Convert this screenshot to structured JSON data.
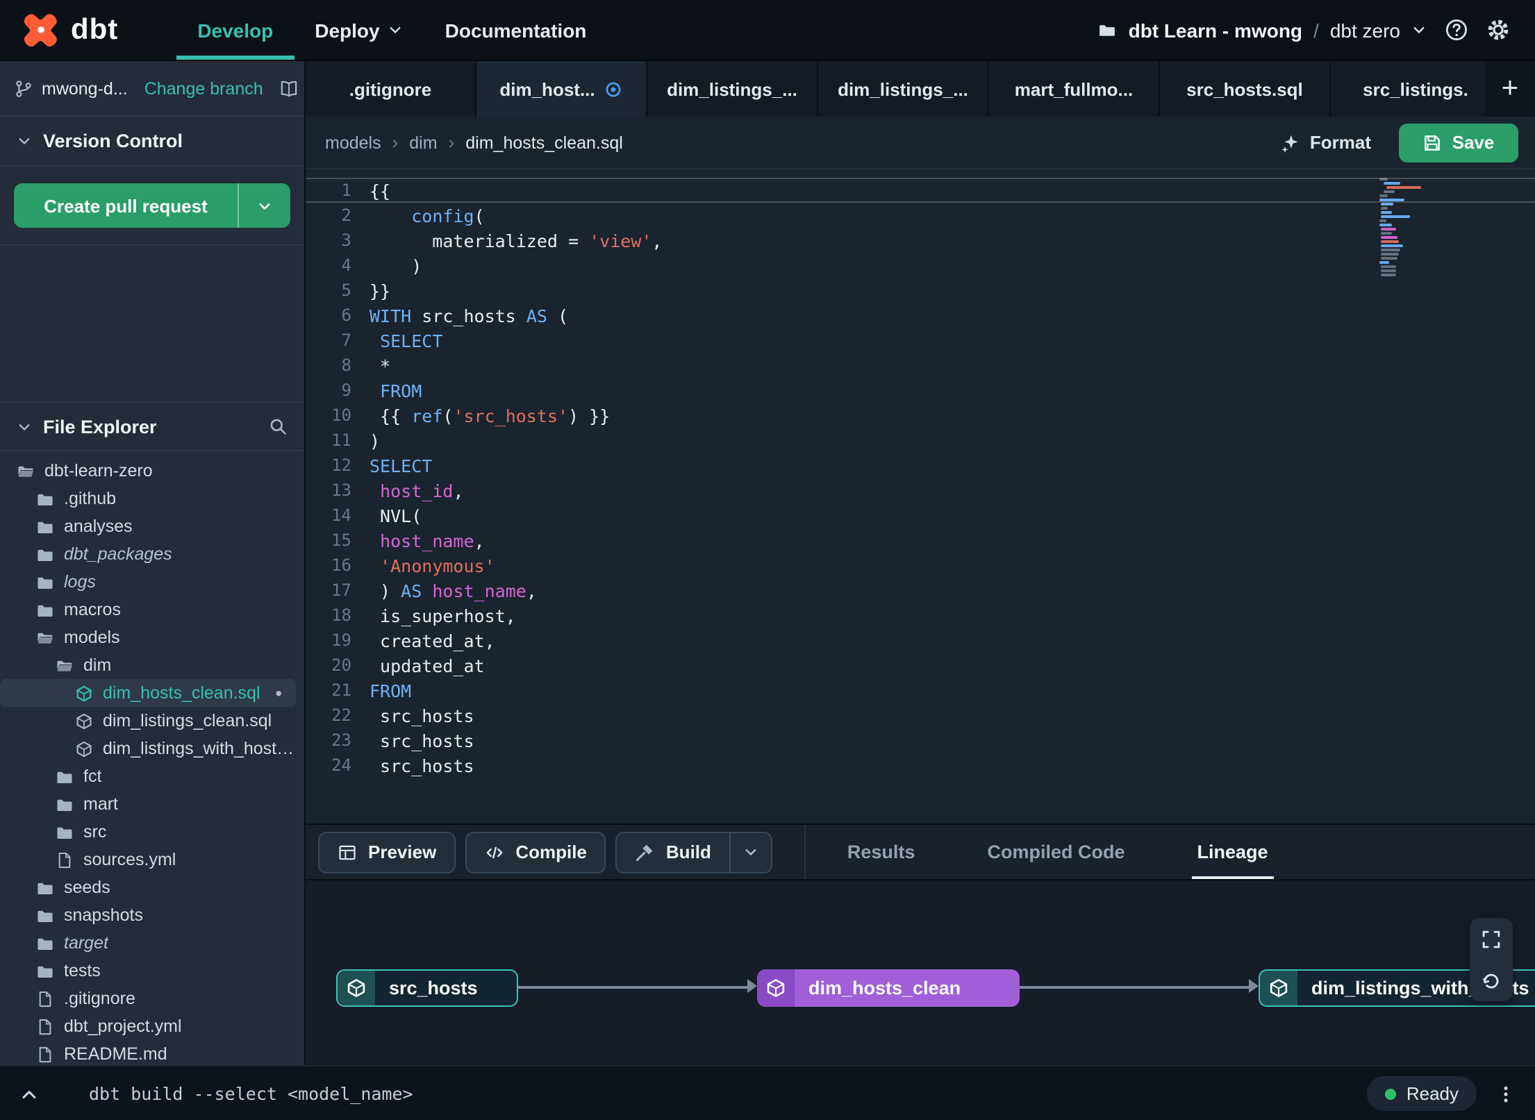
{
  "navbar": {
    "brand": "dbt",
    "items": [
      {
        "label": "Develop",
        "active": true
      },
      {
        "label": "Deploy",
        "caret": true
      },
      {
        "label": "Documentation"
      }
    ],
    "project_name": "dbt Learn - mwong",
    "project_separator": "/",
    "environment": "dbt zero"
  },
  "sidebar": {
    "branch_name": "mwong-d...",
    "change_branch": "Change branch",
    "version_control_title": "Version Control",
    "create_pr_label": "Create pull request",
    "file_explorer_title": "File Explorer",
    "tree": [
      {
        "label": "dbt-learn-zero",
        "icon": "folder-open",
        "depth": 0
      },
      {
        "label": ".github",
        "icon": "folder",
        "depth": 1
      },
      {
        "label": "analyses",
        "icon": "folder",
        "depth": 1
      },
      {
        "label": "dbt_packages",
        "icon": "folder",
        "depth": 1,
        "italic": true
      },
      {
        "label": "logs",
        "icon": "folder",
        "depth": 1,
        "italic": true
      },
      {
        "label": "macros",
        "icon": "folder",
        "depth": 1
      },
      {
        "label": "models",
        "icon": "folder-open",
        "depth": 1
      },
      {
        "label": "dim",
        "icon": "folder-open",
        "depth": 2
      },
      {
        "label": "dim_hosts_clean.sql",
        "icon": "model",
        "depth": 3,
        "selected": true,
        "modified": true
      },
      {
        "label": "dim_listings_clean.sql",
        "icon": "model",
        "depth": 3
      },
      {
        "label": "dim_listings_with_hosts...",
        "icon": "model",
        "depth": 3
      },
      {
        "label": "fct",
        "icon": "folder",
        "depth": 2
      },
      {
        "label": "mart",
        "icon": "folder",
        "depth": 2
      },
      {
        "label": "src",
        "icon": "folder",
        "depth": 2
      },
      {
        "label": "sources.yml",
        "icon": "file",
        "depth": 2
      },
      {
        "label": "seeds",
        "icon": "folder",
        "depth": 1
      },
      {
        "label": "snapshots",
        "icon": "folder",
        "depth": 1
      },
      {
        "label": "target",
        "icon": "folder",
        "depth": 1,
        "italic": true
      },
      {
        "label": "tests",
        "icon": "folder",
        "depth": 1
      },
      {
        "label": ".gitignore",
        "icon": "file",
        "depth": 1
      },
      {
        "label": "dbt_project.yml",
        "icon": "file",
        "depth": 1
      },
      {
        "label": "README.md",
        "icon": "file",
        "depth": 1
      }
    ]
  },
  "editor_tabs": [
    {
      "label": ".gitignore"
    },
    {
      "label": "dim_host...",
      "active": true,
      "dot": true
    },
    {
      "label": "dim_listings_..."
    },
    {
      "label": "dim_listings_..."
    },
    {
      "label": "mart_fullmo..."
    },
    {
      "label": "src_hosts.sql"
    },
    {
      "label": "src_listings."
    }
  ],
  "breadcrumb": [
    "models",
    "dim",
    "dim_hosts_clean.sql"
  ],
  "toolbar": {
    "format_label": "Format",
    "save_label": "Save"
  },
  "code": {
    "lines": [
      {
        "n": 1,
        "cursor": true,
        "seg": [
          [
            "p",
            "{{"
          ]
        ]
      },
      {
        "n": 2,
        "seg": [
          [
            "p",
            "    "
          ],
          [
            "f",
            "config"
          ],
          [
            "p",
            "("
          ]
        ]
      },
      {
        "n": 3,
        "seg": [
          [
            "p",
            "      materialized = "
          ],
          [
            "s",
            "'view'"
          ],
          [
            "p",
            ","
          ]
        ]
      },
      {
        "n": 4,
        "seg": [
          [
            "p",
            "    )"
          ]
        ]
      },
      {
        "n": 5,
        "seg": [
          [
            "p",
            "}}"
          ]
        ]
      },
      {
        "n": 6,
        "seg": [
          [
            "k",
            "WITH"
          ],
          [
            "p",
            " src_hosts "
          ],
          [
            "k",
            "AS"
          ],
          [
            "p",
            " ("
          ]
        ]
      },
      {
        "n": 7,
        "seg": [
          [
            "p",
            " "
          ],
          [
            "k",
            "SELECT"
          ]
        ]
      },
      {
        "n": 8,
        "seg": [
          [
            "p",
            " *"
          ]
        ]
      },
      {
        "n": 9,
        "seg": [
          [
            "p",
            " "
          ],
          [
            "k",
            "FROM"
          ]
        ]
      },
      {
        "n": 10,
        "seg": [
          [
            "p",
            " {{ "
          ],
          [
            "f",
            "ref"
          ],
          [
            "p",
            "("
          ],
          [
            "s",
            "'src_hosts'"
          ],
          [
            "p",
            ") }}"
          ]
        ]
      },
      {
        "n": 11,
        "seg": [
          [
            "p",
            ")"
          ]
        ]
      },
      {
        "n": 12,
        "seg": [
          [
            "k",
            "SELECT"
          ]
        ]
      },
      {
        "n": 13,
        "seg": [
          [
            "p",
            " "
          ],
          [
            "i",
            "host_id"
          ],
          [
            "p",
            ","
          ]
        ]
      },
      {
        "n": 14,
        "seg": [
          [
            "p",
            " NVL("
          ]
        ]
      },
      {
        "n": 15,
        "seg": [
          [
            "p",
            " "
          ],
          [
            "i",
            "host_name"
          ],
          [
            "p",
            ","
          ]
        ]
      },
      {
        "n": 16,
        "seg": [
          [
            "p",
            " "
          ],
          [
            "s",
            "'Anonymous'"
          ]
        ]
      },
      {
        "n": 17,
        "seg": [
          [
            "p",
            " ) "
          ],
          [
            "k",
            "AS"
          ],
          [
            "p",
            " "
          ],
          [
            "i",
            "host_name"
          ],
          [
            "p",
            ","
          ]
        ]
      },
      {
        "n": 18,
        "seg": [
          [
            "p",
            " is_superhost,"
          ]
        ]
      },
      {
        "n": 19,
        "seg": [
          [
            "p",
            " created_at,"
          ]
        ]
      },
      {
        "n": 20,
        "seg": [
          [
            "p",
            " updated_at"
          ]
        ]
      },
      {
        "n": 21,
        "seg": [
          [
            "k",
            "FROM"
          ]
        ]
      },
      {
        "n": 22,
        "seg": [
          [
            "p",
            " src_hosts"
          ]
        ]
      },
      {
        "n": 23,
        "seg": [
          [
            "p",
            " src_hosts"
          ]
        ]
      },
      {
        "n": 24,
        "seg": [
          [
            "p",
            " src_hosts"
          ]
        ]
      }
    ]
  },
  "bottom_panel": {
    "preview_label": "Preview",
    "compile_label": "Compile",
    "build_label": "Build",
    "tabs": [
      {
        "label": "Results"
      },
      {
        "label": "Compiled Code"
      },
      {
        "label": "Lineage",
        "active": true
      }
    ],
    "lineage": {
      "nodes": [
        {
          "label": "src_hosts",
          "color": "teal"
        },
        {
          "label": "dim_hosts_clean",
          "color": "purple"
        },
        {
          "label": "dim_listings_with_hosts",
          "color": "teal"
        }
      ]
    }
  },
  "status_bar": {
    "command": "dbt build --select <model_name>",
    "status": "Ready"
  },
  "colors": {
    "accent_teal": "#36c0b2",
    "green": "#2a9d68",
    "purple": "#a05ed8",
    "brand_orange": "#ff5c35",
    "keyword_blue": "#6fb1f5",
    "string_red": "#e1705c",
    "ident_magenta": "#d466d4"
  }
}
